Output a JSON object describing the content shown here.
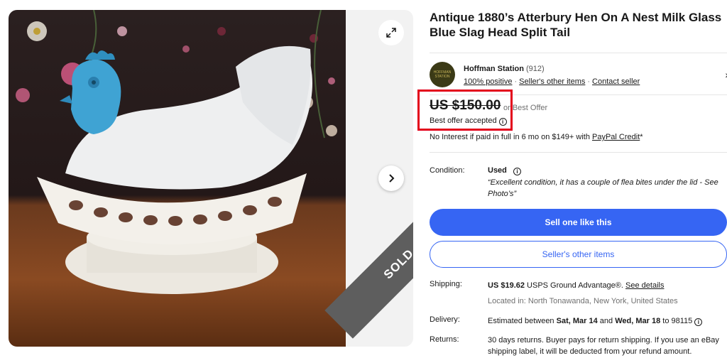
{
  "listing": {
    "title": "Antique 1880’s Atterbury Hen On A Nest Milk Glass Blue Slag Head Split Tail",
    "sold_badge": "SOLD",
    "icons": {
      "expand": "expand-icon",
      "next": "chevron-right-icon"
    }
  },
  "seller": {
    "name": "Hoffman Station",
    "feedback_count": "(912)",
    "positive": "100% positive",
    "other_items_link": "Seller's other items",
    "contact_link": "Contact seller",
    "avatar_text": "HOFFMAN STATION"
  },
  "price": {
    "amount": "US $150.00",
    "best_offer": "or Best Offer",
    "offer_accepted": "Best offer accepted",
    "credit_text": "No Interest if paid in full in 6 mo on $149+ with",
    "credit_link": "PayPal Credit",
    "credit_suffix": "*"
  },
  "condition": {
    "label": "Condition:",
    "value": "Used",
    "note": "“Excellent condition, it has a couple of flea bites under the lid - See Photo’s”"
  },
  "buttons": {
    "sell_one": "Sell one like this",
    "seller_items": "Seller's other items"
  },
  "shipping": {
    "label": "Shipping:",
    "cost": "US $19.62",
    "service": "USPS Ground Advantage",
    "reg": "®.",
    "details_link": "See details",
    "location": "Located in: North Tonawanda, New York, United States"
  },
  "delivery": {
    "label": "Delivery:",
    "prefix": "Estimated between",
    "start": "Sat, Mar 14",
    "and": "and",
    "end": "Wed, Mar 18",
    "suffix": "to 98115"
  },
  "returns": {
    "label": "Returns:",
    "text": "30 days returns. Buyer pays for return shipping. If you use an eBay shipping label, it will be deducted from your refund amount."
  },
  "colors": {
    "accent": "#3665f3",
    "highlight_box": "#e3001b",
    "sold_ribbon": "#5e5e5e"
  }
}
